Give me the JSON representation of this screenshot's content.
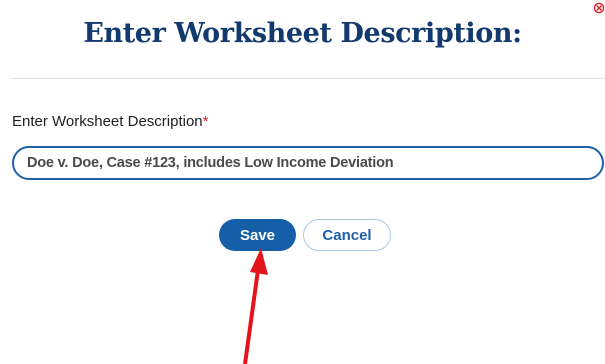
{
  "dialog": {
    "title": "Enter Worksheet Description:",
    "field_label": "Enter Worksheet Description",
    "required_marker": "*",
    "input_value": "Doe v. Doe, Case #123, includes Low Income Deviation",
    "save_label": "Save",
    "cancel_label": "Cancel"
  },
  "icons": {
    "close": "close-icon",
    "annotation": "red-arrow-annotation"
  },
  "colors": {
    "title": "#123a6e",
    "primary": "#155fa9",
    "required": "#e0202a",
    "close": "#d9222a",
    "annotation_arrow": "#e3141b"
  }
}
